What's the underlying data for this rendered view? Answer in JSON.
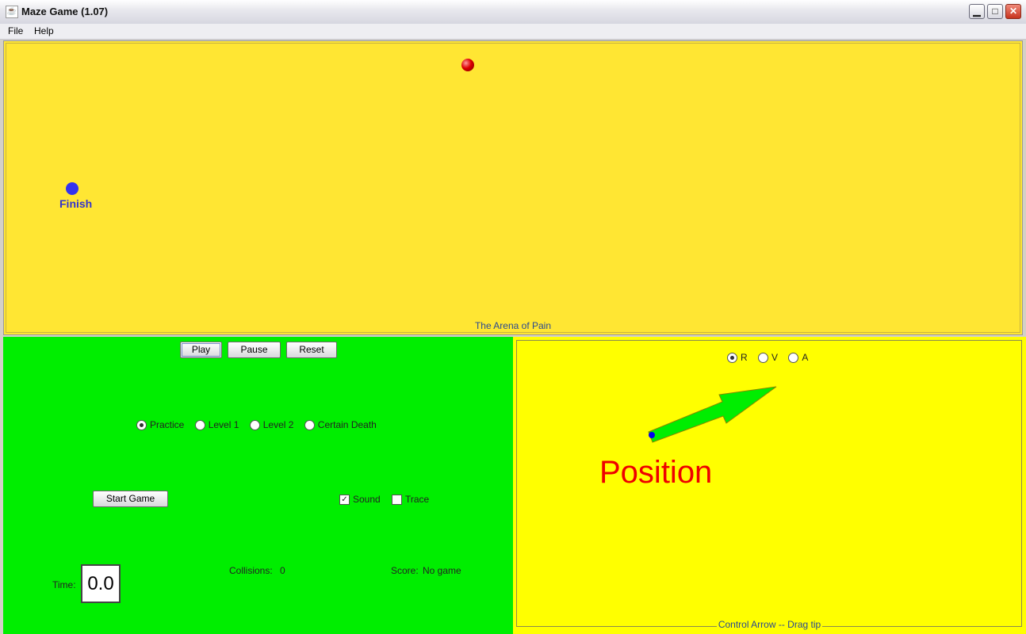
{
  "window": {
    "title": "Maze Game (1.07)",
    "minimize_glyph": "▁",
    "maximize_glyph": "□",
    "close_glyph": "✕"
  },
  "menu": {
    "items": [
      "File",
      "Help"
    ]
  },
  "arena": {
    "finish_label": "Finish",
    "caption": "The Arena of Pain",
    "colors": {
      "background": "#ffe633",
      "ball": "#dd0000",
      "finish": "#3333ee"
    }
  },
  "controls": {
    "buttons": {
      "play": "Play",
      "pause": "Pause",
      "reset": "Reset",
      "start_game": "Start Game"
    },
    "levels": [
      {
        "label": "Practice",
        "selected": true
      },
      {
        "label": "Level 1",
        "selected": false
      },
      {
        "label": "Level 2",
        "selected": false
      },
      {
        "label": "Certain Death",
        "selected": false
      }
    ],
    "sound": {
      "label": "Sound",
      "checked": true
    },
    "trace": {
      "label": "Trace",
      "checked": false
    },
    "time_label": "Time:",
    "time_value": "0.0",
    "collisions_label": "Collisions:",
    "collisions_value": "0",
    "score_label": "Score:",
    "score_value": "No game",
    "panel_color": "#00ee00"
  },
  "control_arrow": {
    "modes": [
      {
        "label": "R",
        "selected": true
      },
      {
        "label": "V",
        "selected": false
      },
      {
        "label": "A",
        "selected": false
      }
    ],
    "mode_label": "Position",
    "caption": "Control Arrow -- Drag tip",
    "colors": {
      "background": "#ffff00",
      "arrow": "#00ee00",
      "label": "#ee0000"
    }
  }
}
